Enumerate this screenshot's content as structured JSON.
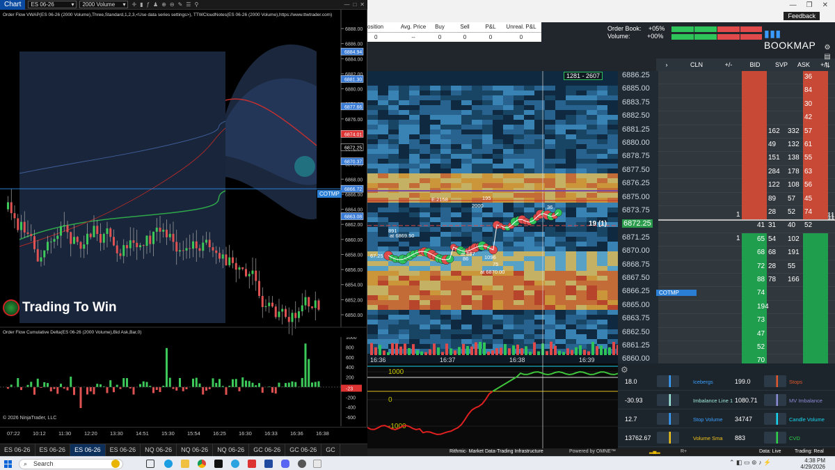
{
  "ninjatrader": {
    "app_label": "Chart",
    "instrument": "ES 06-26",
    "bar_type": "2000 Volume",
    "indicator_label": "Order Flow VWAP(ES 06-26 (2000 Volume),Three,Standard,1,2,3,<Use data series settings>), TTWCloudNotes(ES 06-26 (2000 Volume),https://www.ttwtrader.com)",
    "delta_label": "Order Flow Cumulative Delta(ES 06-26 (2000 Volume),Bid Ask,Bar,0)",
    "price_ticks": [
      "6888.00",
      "6886.00",
      "6884.00",
      "6882.00",
      "6880.00",
      "6878.00",
      "6876.00",
      "6874.00",
      "6872.00",
      "6870.00",
      "6868.00",
      "6866.00",
      "6864.00",
      "6862.00",
      "6860.00",
      "6858.00",
      "6856.00",
      "6854.00",
      "6852.00",
      "6850.00"
    ],
    "price_tags": [
      {
        "label": "6884.94",
        "price": 6884.94,
        "color": "#3a7bd5"
      },
      {
        "label": "6881.30",
        "price": 6881.3,
        "color": "#3a7bd5"
      },
      {
        "label": "6877.66",
        "price": 6877.66,
        "color": "#3a7bd5"
      },
      {
        "label": "6874.01",
        "price": 6874.01,
        "color": "#d33"
      },
      {
        "label": "6872.25",
        "price": 6872.25,
        "color": "#000"
      },
      {
        "label": "6870.37",
        "price": 6870.37,
        "color": "#3a7bd5"
      },
      {
        "label": "6866.72",
        "price": 6866.72,
        "color": "#3a7bd5"
      },
      {
        "label": "6863.08",
        "price": 6863.08,
        "color": "#3a7bd5"
      }
    ],
    "cotmp_label": "COTMP",
    "cotmp_price": 6866.72,
    "delta_ticks": [
      "1000",
      "800",
      "600",
      "400",
      "200",
      "0",
      "-200",
      "-400",
      "-600"
    ],
    "delta_tag": "-23",
    "time_ticks": [
      "07:22",
      "10:12",
      "11:30",
      "12:20",
      "13:30",
      "14:51",
      "15:30",
      "15:54",
      "16:25",
      "16:30",
      "16:33",
      "16:36",
      "16:38"
    ],
    "copyright": "© 2026 NinjaTrader, LLC",
    "watermark": "Trading To Win",
    "tabs": [
      "ES 06-26",
      "ES 06-26",
      "ES 06-26",
      "ES 06-26",
      "NQ 06-26",
      "NQ 06-26",
      "NQ 06-26",
      "GC 06-26",
      "GC 06-26",
      "GC"
    ],
    "active_tab": 2
  },
  "bookmap": {
    "window_controls": [
      "—",
      "❐",
      "✕"
    ],
    "feedback": "Feedback",
    "pnl_headers": [
      "osition",
      "Avg. Price",
      "Buy",
      "Sell",
      "P&L",
      "Unreal. P&L"
    ],
    "pnl_values": [
      "0",
      "--",
      "0",
      "0",
      "0",
      "0"
    ],
    "order_book_label": "Order Book:",
    "order_book_value": "+05%",
    "volume_label": "Volume:",
    "volume_value": "+00%",
    "logo": "BOOKMAP",
    "ladder_headers": [
      "CLN",
      "+/-",
      "BID",
      "SVP",
      "ASK",
      "+/-"
    ],
    "range_box": "1281 - 2607",
    "prices": [
      "6886.25",
      "6885.00",
      "6883.75",
      "6882.50",
      "6881.25",
      "6880.00",
      "6878.75",
      "6877.50",
      "6876.25",
      "6875.00",
      "6873.75",
      "6872.25",
      "6871.25",
      "6870.00",
      "6868.75",
      "6867.50",
      "6866.25",
      "6865.00",
      "6863.75",
      "6862.50",
      "6861.25",
      "6860.00"
    ],
    "current_price": "6872.25",
    "current_label": "19 (1)",
    "ask_sizes": [
      "36",
      "84",
      "30",
      "42",
      "57",
      "61",
      "55",
      "63",
      "56",
      "45",
      "74",
      "52"
    ],
    "bid_sizes": [
      "41",
      "65",
      "68",
      "72",
      "88",
      "74",
      "194",
      "73",
      "47",
      "52",
      "70"
    ],
    "svp_left": [
      "162",
      "49",
      "151",
      "284",
      "122",
      "89",
      "28",
      "31",
      "54",
      "68",
      "28",
      "78"
    ],
    "svp_right": [
      "332",
      "132",
      "138",
      "178",
      "108",
      "57",
      "52",
      "40",
      "102",
      "191",
      "55",
      "166"
    ],
    "ladder_marks": [
      "11",
      "1",
      "1",
      "11"
    ],
    "ladder_cotmp": "COTMP",
    "heat_time_labels": [
      "16:36",
      "16:37",
      "16:38",
      "16:39"
    ],
    "heat_labels": [
      "E:2158",
      "2000",
      "195",
      "36",
      "891",
      "at 6869.50",
      "at 687",
      "86",
      "1096",
      "75",
      "at 6870.00",
      "67.25"
    ],
    "cvd_levels": [
      "1000",
      "0",
      "-1000"
    ],
    "indicators": [
      {
        "left_value": "18.0",
        "left_name": "Icebergs",
        "left_color": "#3aa0ff",
        "right_value": "199.0",
        "right_name": "Stops",
        "right_color": "#e0582b"
      },
      {
        "left_value": "-30.93",
        "left_name": "Imbalance Line 1",
        "left_color": "#9ee7d8",
        "right_value": "1080.71",
        "right_name": "MV Imbalance",
        "right_color": "#8b8bd6"
      },
      {
        "left_value": "12.7",
        "left_name": "Stop Volume",
        "left_color": "#3aa0ff",
        "right_value": "34747",
        "right_name": "Candle Volume",
        "right_color": "#18d6f0"
      },
      {
        "left_value": "13762.67",
        "left_name": "Volume Sma",
        "left_color": "#f0c419",
        "right_value": "883",
        "right_name": "CVD",
        "right_color": "#2fd34a"
      }
    ],
    "status_left": "R+",
    "status_center": "Rithmic· Market Data-Trading Infrastructure",
    "status_omne": "Powered by OMNE™",
    "data_status": "Data: Live",
    "trading_status": "Trading: Real"
  },
  "taskbar": {
    "search": "Search",
    "time": "4:38 PM",
    "date": "4/29/2026"
  }
}
